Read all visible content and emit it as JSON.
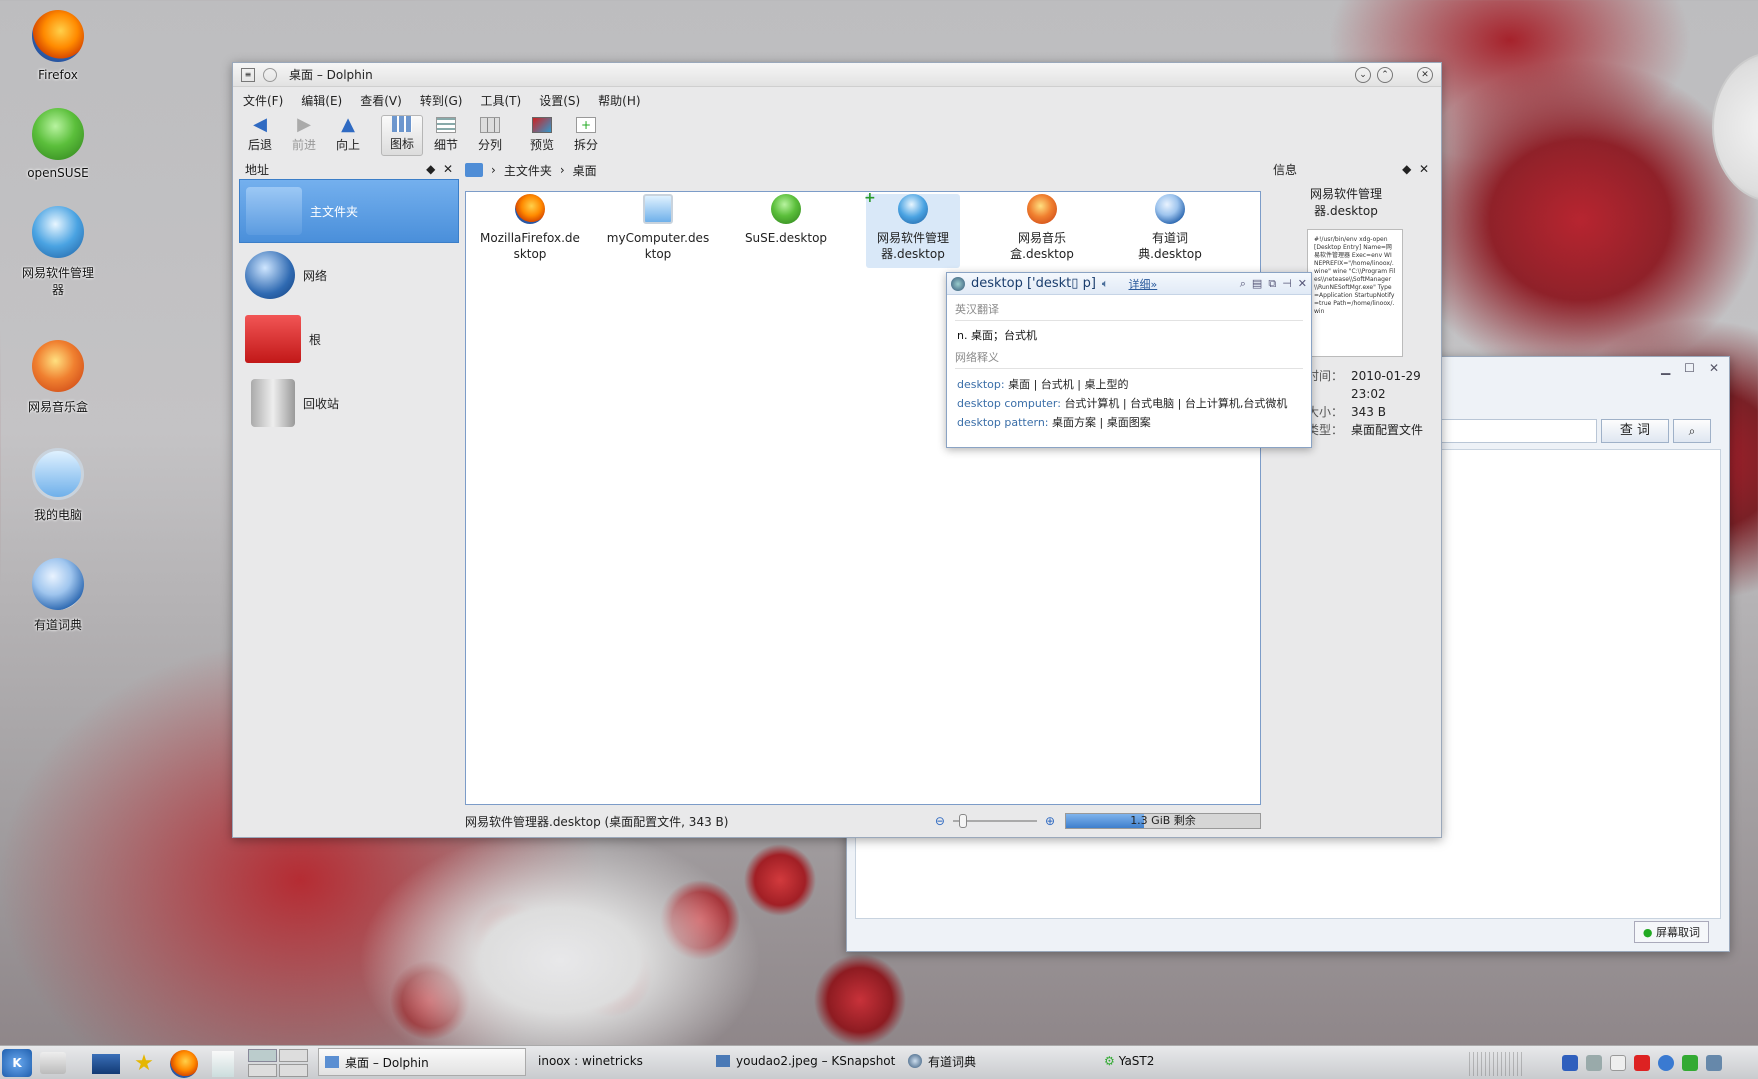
{
  "desktop": {
    "icons": [
      {
        "label": "Firefox",
        "icon": "firefox-icon"
      },
      {
        "label": "openSUSE",
        "icon": "opensuse-icon"
      },
      {
        "label": "网易软件管理器",
        "icon": "software-manager-icon"
      },
      {
        "label": "网易音乐盒",
        "icon": "music-box-icon"
      },
      {
        "label": "我的电脑",
        "icon": "computer-icon"
      },
      {
        "label": "有道词典",
        "icon": "youdao-dict-icon"
      }
    ]
  },
  "dolphin": {
    "title": "桌面 – Dolphin",
    "menu": [
      "文件(F)",
      "编辑(E)",
      "查看(V)",
      "转到(G)",
      "工具(T)",
      "设置(S)",
      "帮助(H)"
    ],
    "toolbar": {
      "back": "后退",
      "forward": "前进",
      "up": "向上",
      "icons": "图标",
      "details": "细节",
      "columns": "分列",
      "preview": "预览",
      "split": "拆分"
    },
    "places": {
      "title": "地址",
      "items": [
        "主文件夹",
        "网络",
        "根",
        "回收站"
      ]
    },
    "breadcrumb": {
      "home": "主文件夹",
      "current": "桌面"
    },
    "files": [
      {
        "name": "MozillaFirefox.de\nsktop",
        "l1": "MozillaFirefox.de",
        "l2": "sktop"
      },
      {
        "l1": "myComputer.des",
        "l2": "ktop"
      },
      {
        "l1": "SuSE.desktop",
        "l2": ""
      },
      {
        "l1": "网易软件管理",
        "l2": "器.desktop"
      },
      {
        "l1": "网易音乐",
        "l2": "盒.desktop"
      },
      {
        "l1": "有道词",
        "l2": "典.desktop"
      }
    ],
    "status": "网易软件管理器.desktop (桌面配置文件, 343 B)",
    "free_space": "1.3 GiB 剩余",
    "free_fraction": 0.4,
    "info": {
      "title": "信息",
      "name_l1": "网易软件管理",
      "name_l2": "器.desktop",
      "preview_text": "#!/usr/bin/env xdg-open [Desktop Entry] Name=网易软件管理器 Exec=env WINEPREFIX=\"/home/linoox/.wine\" wine \"C:\\\\Program Files\\\\netease\\\\SoftManager\\\\RunNESoftMgr.exe\" Type=Application StartupNotify=true Path=/home/linoox/.win",
      "time_label": "时间：",
      "time_l1": "2010-01-29",
      "time_l2": "23:02",
      "size_label": "大小：",
      "size": "343 B",
      "type_label": "类型：",
      "type": "桌面配置文件"
    }
  },
  "dict_popup": {
    "word": "desktop ['deskt▯ p]",
    "detail": "详细»",
    "sec1": "英汉翻译",
    "def": "n. 桌面；台式机",
    "sec2": "网络释义",
    "entries": [
      {
        "term": "desktop:",
        "meaning": "桌面 | 台式机 | 桌上型的"
      },
      {
        "term": "desktop computer:",
        "meaning": "台式计算机 | 台式电脑 | 台上计算机,台式微机"
      },
      {
        "term": "desktop pattern:",
        "meaning": "桌面方案 | 桌面图案"
      }
    ]
  },
  "youdao_window": {
    "search_button": "查 词",
    "screen_capture": "屏幕取词"
  },
  "taskbar": {
    "tasks": [
      "桌面 – Dolphin",
      "inoox : winetricks",
      "youdao2.jpeg – KSnapshot",
      "有道词典",
      "YaST2"
    ]
  }
}
